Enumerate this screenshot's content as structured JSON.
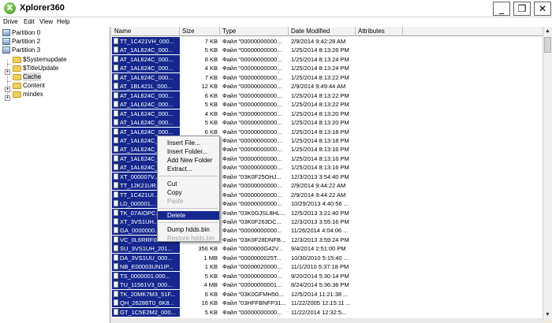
{
  "window": {
    "title": "Xplorer360",
    "app_icon": "X",
    "minimize_glyph": "_",
    "maximize_glyph": "❐",
    "close_glyph": "✕"
  },
  "menu": [
    "Drive",
    "Edit",
    "View",
    "Help"
  ],
  "tree": {
    "items": [
      {
        "label": "Partition 0",
        "icon": "drive-icon"
      },
      {
        "label": "Partition 2",
        "icon": "drive-icon"
      },
      {
        "label": "Partition 3",
        "icon": "drive-icon"
      },
      {
        "label": "$Systemupdate",
        "icon": "folder-icon"
      },
      {
        "label": "$TitleUpdate",
        "icon": "folder-icon"
      },
      {
        "label": "Cache",
        "icon": "folder-icon",
        "selected": true
      },
      {
        "label": "Content",
        "icon": "folder-icon"
      },
      {
        "label": "mindex",
        "icon": "folder-icon"
      }
    ],
    "expander_plus": "+"
  },
  "columns": {
    "name": "Name",
    "size": "Size",
    "type": "Type",
    "date": "Date Modified",
    "attributes": "Attributes"
  },
  "files": [
    {
      "name": "TT_1C421VH_000...",
      "size": "7 KB",
      "type": "Файл \"00000000000...",
      "date": "2/9/2014 9:42:28 AM"
    },
    {
      "name": "AT_1AL624C_000...",
      "size": "5 KB",
      "type": "Файл \"00000000000...",
      "date": "1/25/2014 8:13:26 PM"
    },
    {
      "name": "AT_1AL624C_000...",
      "size": "8 KB",
      "type": "Файл \"00000000000...",
      "date": "1/25/2014 8:13:24 PM"
    },
    {
      "name": "AT_1AL624C_000...",
      "size": "4 KB",
      "type": "Файл \"00000000000...",
      "date": "1/25/2014 8:13:24 PM"
    },
    {
      "name": "AT_1AL624C_000...",
      "size": "7 KB",
      "type": "Файл \"00000000000...",
      "date": "1/25/2014 8:13:22 PM"
    },
    {
      "name": "AT_1BL421L_000...",
      "size": "12 KB",
      "type": "Файл \"00000000000...",
      "date": "2/9/2014 9:49:44 AM"
    },
    {
      "name": "AT_1AL624C_000...",
      "size": "6 KB",
      "type": "Файл \"00000000000...",
      "date": "1/25/2014 8:13:22 PM"
    },
    {
      "name": "AT_1AL624C_000...",
      "size": "5 KB",
      "type": "Файл \"00000000000...",
      "date": "1/25/2014 8:13:22 PM"
    },
    {
      "name": "AT_1AL624C_000...",
      "size": "4 KB",
      "type": "Файл \"00000000000...",
      "date": "1/25/2014 8:13:20 PM"
    },
    {
      "name": "AT_1AL624C_000...",
      "size": "5 KB",
      "type": "Файл \"00000000000...",
      "date": "1/25/2014 8:13:20 PM"
    },
    {
      "name": "AT_1AL624C_000...",
      "size": "6 KB",
      "type": "Файл \"00000000000...",
      "date": "1/25/2014 8:13:18 PM"
    },
    {
      "name": "AT_1AL624C_000...",
      "size": "6 KB",
      "type": "Файл \"00000000000...",
      "date": "1/25/2014 8:13:18 PM"
    },
    {
      "name": "AT_1AL624C_000...",
      "size": "5 KB",
      "type": "Файл \"00000000000...",
      "date": "1/25/2014 8:13:16 PM"
    },
    {
      "name": "AT_1AL624C_000...",
      "size": "5 KB",
      "type": "Файл \"00000000000...",
      "date": "1/25/2014 8:13:16 PM"
    },
    {
      "name": "AT_1AL624C_000...",
      "size": "5 KB",
      "type": "Файл \"00000000000...",
      "date": "1/25/2014 8:13:16 PM"
    },
    {
      "name": "XT_000007V...",
      "size": "5 KB",
      "type": "Файл \"03K0F25OHJ...",
      "date": "12/3/2013 3:54:40 PM"
    },
    {
      "name": "TT_12K21UR...",
      "size": "5 KB",
      "type": "Файл \"00000000000...",
      "date": "2/9/2014 9:44:22 AM"
    },
    {
      "name": "TT_1C421UI...",
      "size": "5 KB",
      "type": "Файл \"00000000000...",
      "date": "2/9/2014 9:44:22 AM"
    },
    {
      "name": "LD_000001...",
      "size": "5 KB",
      "type": "Файл \"00000000000...",
      "date": "10/29/2013 4:40:56 ..."
    },
    {
      "name": "TK_07AIOPC...",
      "size": "5 KB",
      "type": "Файл \"03K0GJSL8HL...",
      "date": "12/5/2013 3:21:40 PM"
    },
    {
      "name": "XT_3VS1UH...",
      "size": "5 KB",
      "type": "Файл \"03K0F263DC...",
      "date": "12/3/2013 3:55:16 PM"
    },
    {
      "name": "GA_0000000...",
      "size": "5 KB",
      "type": "Файл \"00000000000...",
      "date": "11/26/2014 4:04:06 ..."
    },
    {
      "name": "VC_0L6RRF0...",
      "size": "5 KB",
      "type": "Файл \"03K0F28DNFB...",
      "date": "12/3/2013 3:59:24 PM"
    },
    {
      "name": "SU_3VS1UH_201...",
      "size": "356 KB",
      "type": "Файл \"0000000G42V...",
      "date": "9/4/2014 2:51:00 PM"
    },
    {
      "name": "DA_3VS1UU_000...",
      "size": "1 MB",
      "type": "Файл \"0000000025T...",
      "date": "10/30/2010 5:15:40 ..."
    },
    {
      "name": "NB_E00003UN1IP...",
      "size": "1 KB",
      "type": "Файл \"00000020000...",
      "date": "11/1/2010 5:37:18 PM"
    },
    {
      "name": "TS_0000001.000...",
      "size": "5 KB",
      "type": "Файл \"00000000000...",
      "date": "9/20/2014 5:30:14 PM"
    },
    {
      "name": "TU_11561V3_000...",
      "size": "4 MB",
      "type": "Файл \"00000000001...",
      "date": "8/24/2014 5:36:36 PM"
    },
    {
      "name": "TK_20MK7M3_51F...",
      "size": "6 KB",
      "type": "Файл \"03K0GFMH50...",
      "date": "12/5/2014 11:21:38 ..."
    },
    {
      "name": "QH_26286T0_6K8...",
      "size": "16 KB",
      "type": "Файл \"03HFFBNFP31...",
      "date": "11/22/2005 12:15:11 ..."
    },
    {
      "name": "GT_1C5E2M2_000...",
      "size": "5 KB",
      "type": "Файл \"00000000000...",
      "date": "11/22/2014 12:32:5..."
    }
  ],
  "context_menu": {
    "items": [
      {
        "label": "Insert File...",
        "disabled": false
      },
      {
        "label": "Insert Folder...",
        "disabled": false
      },
      {
        "label": "Add New Folder",
        "disabled": false
      },
      {
        "label": "Extract...",
        "disabled": false
      },
      {
        "label": "Cut",
        "disabled": false
      },
      {
        "label": "Copy",
        "disabled": false
      },
      {
        "label": "Paste",
        "disabled": true
      },
      {
        "label": "Delete",
        "disabled": false,
        "highlighted": true
      },
      {
        "label": "Dump hdds.bin",
        "disabled": false
      },
      {
        "label": "Restore hdds.bin",
        "disabled": true
      }
    ]
  },
  "scrollbar": {
    "up_glyph": "▲",
    "down_glyph": "▼"
  },
  "colors": {
    "selection": "#16288e",
    "window_bg": "#ffffff",
    "chrome_bg": "#ece9d8"
  }
}
